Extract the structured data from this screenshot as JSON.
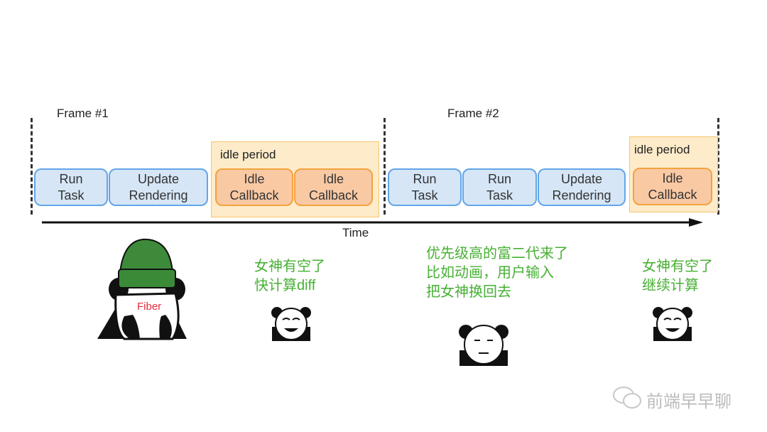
{
  "frames": [
    {
      "label": "Frame #1"
    },
    {
      "label": "Frame #2"
    }
  ],
  "idle_period_label": "idle period",
  "tasks": [
    {
      "label": "Run\nTask",
      "type": "task"
    },
    {
      "label": "Update\nRendering",
      "type": "render"
    },
    {
      "label": "Idle\nCallback",
      "type": "idle"
    },
    {
      "label": "Idle\nCallback",
      "type": "idle"
    },
    {
      "label": "Run\nTask",
      "type": "task"
    },
    {
      "label": "Run\nTask",
      "type": "task"
    },
    {
      "label": "Update\nRendering",
      "type": "render"
    },
    {
      "label": "Idle\nCallback",
      "type": "idle"
    }
  ],
  "axis_label": "Time",
  "fiber_label": "Fiber",
  "captions": [
    "女神有空了\n快计算diff",
    "优先级高的富二代来了\n比如动画，用户输入\n把女神换回去",
    "女神有空了\n继续计算"
  ],
  "watermark": "前端早早聊",
  "colors": {
    "task_fill": "#d6e6f6",
    "task_border": "#63a5e8",
    "idle_fill": "#f9c9a4",
    "idle_border": "#f4a23e",
    "idle_region": "#fdebc9",
    "caption": "#47b034"
  }
}
